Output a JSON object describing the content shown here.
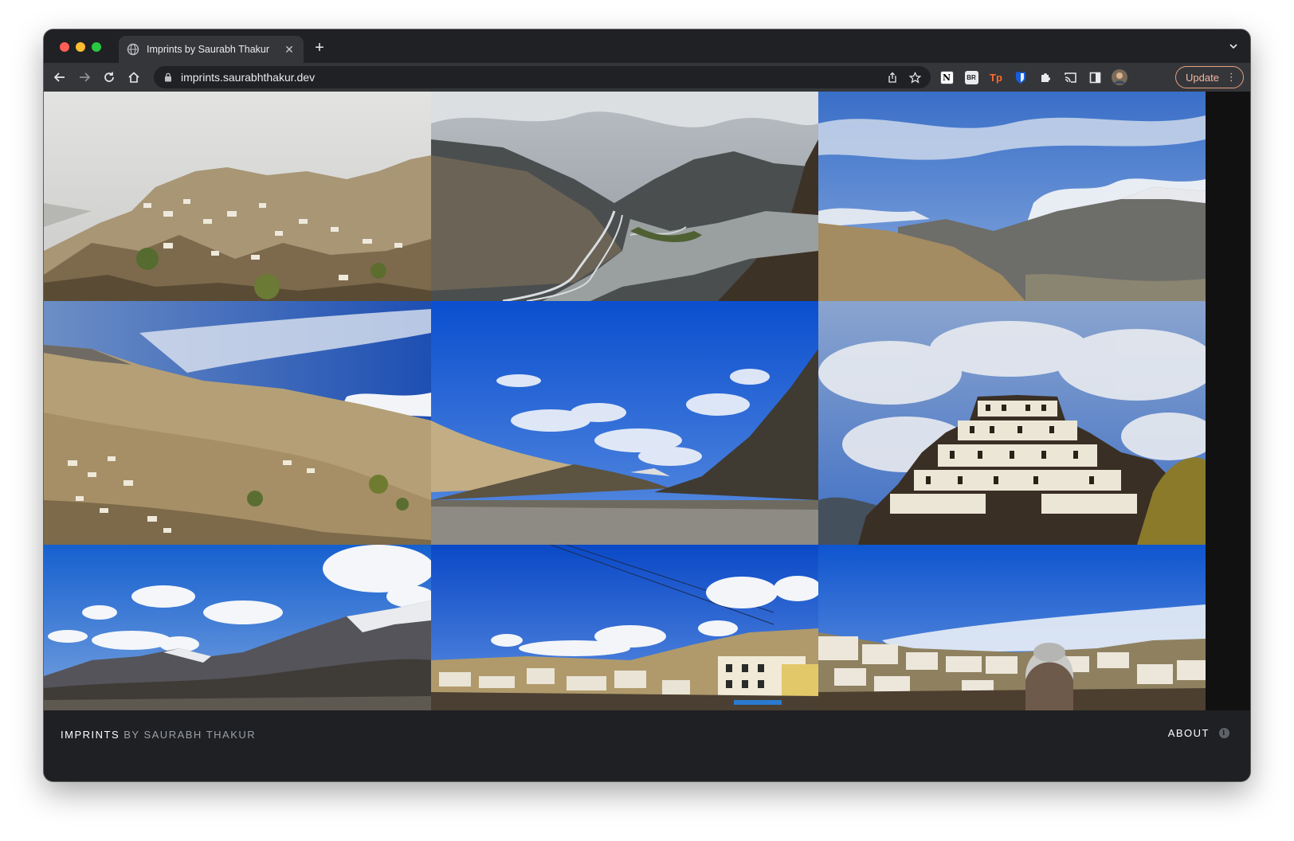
{
  "browser": {
    "tab_title": "Imprints by Saurabh Thakur",
    "tab_close": "✕",
    "new_tab": "+",
    "url": "imprints.saurabhthakur.dev",
    "update_label": "Update",
    "update_menu": "⋮",
    "extensions": [
      {
        "name": "notion-icon",
        "label": "N"
      },
      {
        "name": "br-extension-icon",
        "label": "BR"
      },
      {
        "name": "tp-extension-icon",
        "label": "Tp"
      },
      {
        "name": "bitwarden-icon",
        "label": ""
      },
      {
        "name": "puzzle-extensions-icon",
        "label": ""
      },
      {
        "name": "cast-icon",
        "label": ""
      },
      {
        "name": "side-panel-icon",
        "label": ""
      },
      {
        "name": "profile-avatar",
        "label": ""
      }
    ]
  },
  "gallery": {
    "photos": [
      {
        "name": "photo-dhankar-village-cloudy"
      },
      {
        "name": "photo-river-valley-storm"
      },
      {
        "name": "photo-snow-peaks-clouds"
      },
      {
        "name": "photo-hillside-village-sky"
      },
      {
        "name": "photo-valley-blue-sky"
      },
      {
        "name": "photo-key-monastery"
      },
      {
        "name": "photo-snow-mountain-range"
      },
      {
        "name": "photo-kaza-town-blue"
      },
      {
        "name": "photo-town-with-beanie"
      }
    ]
  },
  "footer": {
    "brand": "IMPRINTS",
    "by": "BY SAURABH THAKUR",
    "about": "ABOUT",
    "info_glyph": "i"
  }
}
